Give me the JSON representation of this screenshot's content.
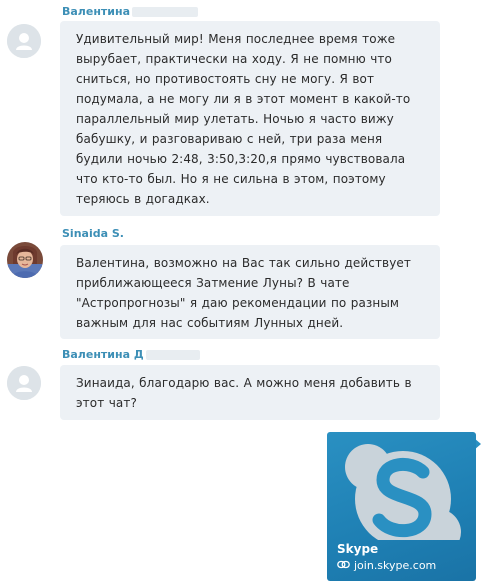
{
  "messages": [
    {
      "sender": "Валентина",
      "avatar": "default-user-icon",
      "text": "Удивительный мир! Меня последнее время тоже вырубает, практически на ходу. Я не помню что сниться, но противостоять сну не могу. Я вот подумала, а не могу ли я в этот момент в какой-то параллельный мир улетать. Ночью я часто вижу бабушку, и разговариваю с ней, три раза меня будили ночью 2:48, 3:50,3:20,я прямо чувствовала что кто-то был. Но я не сильна в этом, поэтому теряюсь в догадках."
    },
    {
      "sender": "Sinaida S.",
      "avatar": "user-photo",
      "text": "Валентина, возможно на Вас так сильно действует приближающееся Затмение Луны? В чате \"Астропрогнозы\" я даю рекомендации по разным важным для нас событиям Лунных дней."
    },
    {
      "sender": "Валентина Д",
      "avatar": "default-user-icon",
      "text": "Зинаида, благодарю вас. А можно меня добавить в этот чат?"
    }
  ],
  "link_card": {
    "title": "Skype",
    "url": "join.skype.com",
    "logo_icon": "skype-logo-icon",
    "link_icon": "link-icon",
    "accent_color": "#2a90c2"
  }
}
